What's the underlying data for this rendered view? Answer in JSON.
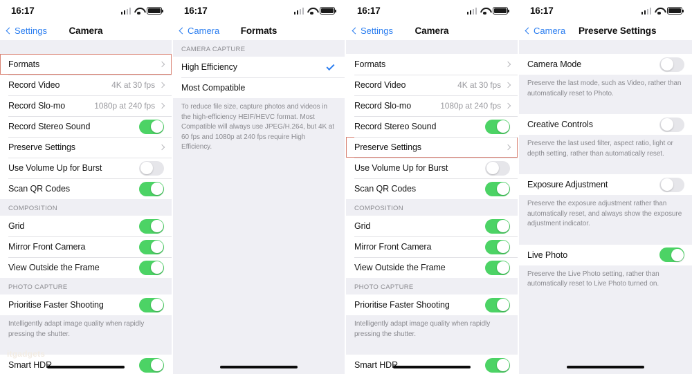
{
  "colors": {
    "accent_blue": "#2a7df0",
    "toggle_on_green": "#4CD365",
    "toggle_off_grey": "#e6e6ea",
    "highlight_border": "#d98273",
    "page_background": "#EFEFF4",
    "group_background": "#ffffff"
  },
  "status_bar": {
    "time": "16:17"
  },
  "panels": [
    {
      "id": "camera-settings-1",
      "nav": {
        "back_label": "Settings",
        "title": "Camera"
      },
      "sections": [
        {
          "header": "",
          "rows": [
            {
              "label": "Formats",
              "value": "",
              "control": "chevron",
              "highlighted": true
            },
            {
              "label": "Record Video",
              "value": "4K at 30 fps",
              "control": "chevron",
              "highlighted": false
            },
            {
              "label": "Record Slo-mo",
              "value": "1080p at 240 fps",
              "control": "chevron",
              "highlighted": false
            },
            {
              "label": "Record Stereo Sound",
              "value": "",
              "control": "toggle-on",
              "highlighted": false
            },
            {
              "label": "Preserve Settings",
              "value": "",
              "control": "chevron",
              "highlighted": false
            },
            {
              "label": "Use Volume Up for Burst",
              "value": "",
              "control": "toggle-off",
              "highlighted": false
            },
            {
              "label": "Scan QR Codes",
              "value": "",
              "control": "toggle-on",
              "highlighted": false
            }
          ],
          "footnote": ""
        },
        {
          "header": "COMPOSITION",
          "rows": [
            {
              "label": "Grid",
              "value": "",
              "control": "toggle-on",
              "highlighted": false
            },
            {
              "label": "Mirror Front Camera",
              "value": "",
              "control": "toggle-on",
              "highlighted": false
            },
            {
              "label": "View Outside the Frame",
              "value": "",
              "control": "toggle-on",
              "highlighted": false
            }
          ],
          "footnote": ""
        },
        {
          "header": "PHOTO CAPTURE",
          "rows": [
            {
              "label": "Prioritise Faster Shooting",
              "value": "",
              "control": "toggle-on",
              "highlighted": false
            }
          ],
          "footnote": "Intelligently adapt image quality when rapidly pressing the shutter."
        },
        {
          "header": "",
          "rows": [
            {
              "label": "Smart HDR",
              "value": "",
              "control": "toggle-on",
              "highlighted": false
            }
          ],
          "footnote": ""
        }
      ],
      "home_indicator": true,
      "watermark": "itgadgets"
    },
    {
      "id": "formats-2",
      "nav": {
        "back_label": "Camera",
        "title": "Formats"
      },
      "sections": [
        {
          "header": "CAMERA CAPTURE",
          "rows": [
            {
              "label": "High Efficiency",
              "value": "",
              "control": "check",
              "highlighted": false
            },
            {
              "label": "Most Compatible",
              "value": "",
              "control": "none",
              "highlighted": false
            }
          ],
          "footnote": "To reduce file size, capture photos and videos in the high-efficiency HEIF/HEVC format. Most Compatible will always use JPEG/H.264, but 4K at 60 fps and 1080p at 240 fps require High Efficiency."
        }
      ],
      "home_indicator": true,
      "watermark": ""
    },
    {
      "id": "camera-settings-3",
      "nav": {
        "back_label": "Settings",
        "title": "Camera"
      },
      "sections": [
        {
          "header": "",
          "rows": [
            {
              "label": "Formats",
              "value": "",
              "control": "chevron",
              "highlighted": false
            },
            {
              "label": "Record Video",
              "value": "4K at 30 fps",
              "control": "chevron",
              "highlighted": false
            },
            {
              "label": "Record Slo-mo",
              "value": "1080p at 240 fps",
              "control": "chevron",
              "highlighted": false
            },
            {
              "label": "Record Stereo Sound",
              "value": "",
              "control": "toggle-on",
              "highlighted": false
            },
            {
              "label": "Preserve Settings",
              "value": "",
              "control": "chevron",
              "highlighted": true
            },
            {
              "label": "Use Volume Up for Burst",
              "value": "",
              "control": "toggle-off",
              "highlighted": false
            },
            {
              "label": "Scan QR Codes",
              "value": "",
              "control": "toggle-on",
              "highlighted": false
            }
          ],
          "footnote": ""
        },
        {
          "header": "COMPOSITION",
          "rows": [
            {
              "label": "Grid",
              "value": "",
              "control": "toggle-on",
              "highlighted": false
            },
            {
              "label": "Mirror Front Camera",
              "value": "",
              "control": "toggle-on",
              "highlighted": false
            },
            {
              "label": "View Outside the Frame",
              "value": "",
              "control": "toggle-on",
              "highlighted": false
            }
          ],
          "footnote": ""
        },
        {
          "header": "PHOTO CAPTURE",
          "rows": [
            {
              "label": "Prioritise Faster Shooting",
              "value": "",
              "control": "toggle-on",
              "highlighted": false
            }
          ],
          "footnote": "Intelligently adapt image quality when rapidly pressing the shutter."
        },
        {
          "header": "",
          "rows": [
            {
              "label": "Smart HDR",
              "value": "",
              "control": "toggle-on",
              "highlighted": false
            }
          ],
          "footnote": ""
        }
      ],
      "home_indicator": true,
      "watermark": ""
    },
    {
      "id": "preserve-settings-4",
      "nav": {
        "back_label": "Camera",
        "title": "Preserve Settings"
      },
      "sections": [
        {
          "header": "",
          "rows": [
            {
              "label": "Camera Mode",
              "value": "",
              "control": "toggle-off",
              "highlighted": false
            }
          ],
          "footnote": "Preserve the last mode, such as Video, rather than automatically reset to Photo."
        },
        {
          "header": "",
          "rows": [
            {
              "label": "Creative Controls",
              "value": "",
              "control": "toggle-off",
              "highlighted": false
            }
          ],
          "footnote": "Preserve the last used filter, aspect ratio, light or depth setting, rather than automatically reset."
        },
        {
          "header": "",
          "rows": [
            {
              "label": "Exposure Adjustment",
              "value": "",
              "control": "toggle-off",
              "highlighted": false
            }
          ],
          "footnote": "Preserve the exposure adjustment rather than automatically reset, and always show the exposure adjustment indicator."
        },
        {
          "header": "",
          "rows": [
            {
              "label": "Live Photo",
              "value": "",
              "control": "toggle-on",
              "highlighted": false
            }
          ],
          "footnote": "Preserve the Live Photo setting, rather than automatically reset to Live Photo turned on."
        }
      ],
      "home_indicator": true,
      "watermark": ""
    }
  ]
}
